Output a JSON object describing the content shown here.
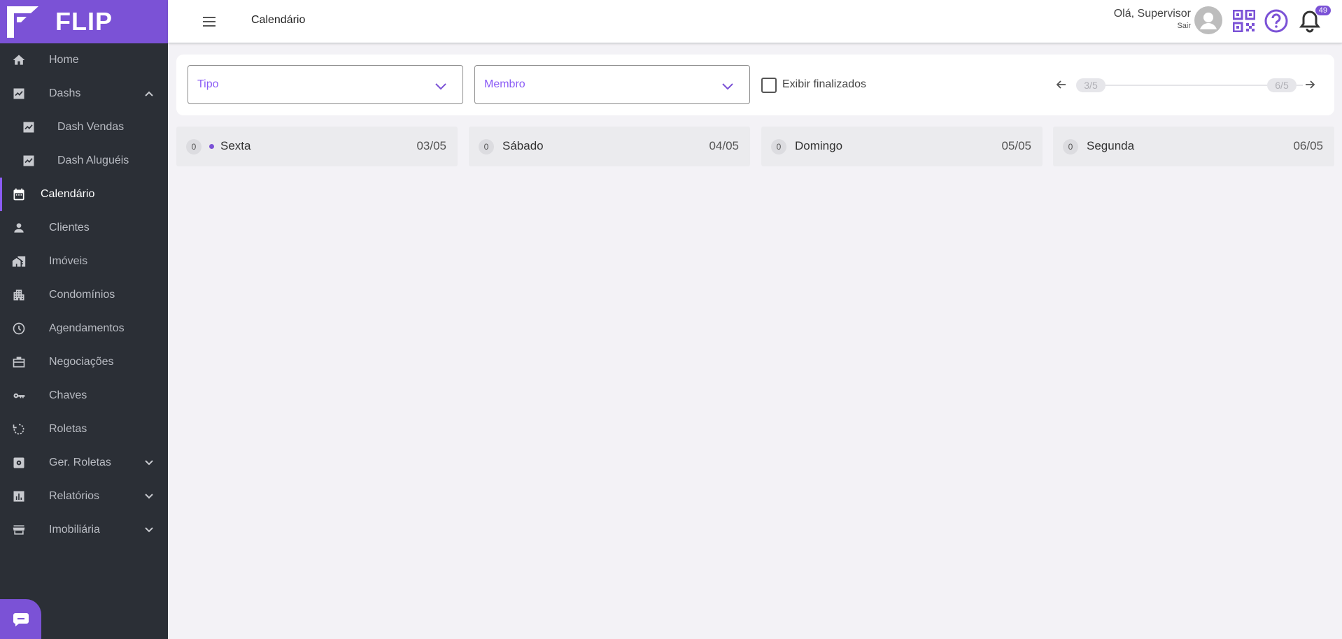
{
  "app": {
    "brand": "FLIP"
  },
  "sidebar": {
    "items": [
      {
        "label": "Home",
        "icon": "home-icon"
      },
      {
        "label": "Dashs",
        "icon": "chart-icon",
        "expanded": true
      },
      {
        "label": "Dash Vendas",
        "icon": "chart-icon",
        "sub": true
      },
      {
        "label": "Dash Aluguéis",
        "icon": "chart-icon",
        "sub": true
      },
      {
        "label": "Calendário",
        "icon": "calendar-icon",
        "active": true
      },
      {
        "label": "Clientes",
        "icon": "person-icon"
      },
      {
        "label": "Imóveis",
        "icon": "buildings-icon"
      },
      {
        "label": "Condomínios",
        "icon": "apartment-icon"
      },
      {
        "label": "Agendamentos",
        "icon": "clock-icon"
      },
      {
        "label": "Negociações",
        "icon": "briefcase-icon"
      },
      {
        "label": "Chaves",
        "icon": "key-icon"
      },
      {
        "label": "Roletas",
        "icon": "rotate-icon"
      },
      {
        "label": "Ger. Roletas",
        "icon": "gear-box-icon",
        "collapsed": true
      },
      {
        "label": "Relatórios",
        "icon": "bar-chart-icon",
        "collapsed": true
      },
      {
        "label": "Imobiliária",
        "icon": "store-icon",
        "collapsed": true
      }
    ]
  },
  "header": {
    "title": "Calendário",
    "greeting": "Olá, Supervisor",
    "logout": "Sair",
    "notifications": "49"
  },
  "filters": {
    "tipo": "Tipo",
    "membro": "Membro",
    "show_finished": "Exibir finalizados",
    "pager_prev": "3/5",
    "pager_next": "6/5"
  },
  "days": [
    {
      "count": "0",
      "name": "Sexta",
      "date": "03/05",
      "today": true
    },
    {
      "count": "0",
      "name": "Sábado",
      "date": "04/05"
    },
    {
      "count": "0",
      "name": "Domingo",
      "date": "05/05"
    },
    {
      "count": "0",
      "name": "Segunda",
      "date": "06/05"
    }
  ],
  "colors": {
    "accent": "#7b52d6",
    "sidebar": "#2b2f36"
  }
}
